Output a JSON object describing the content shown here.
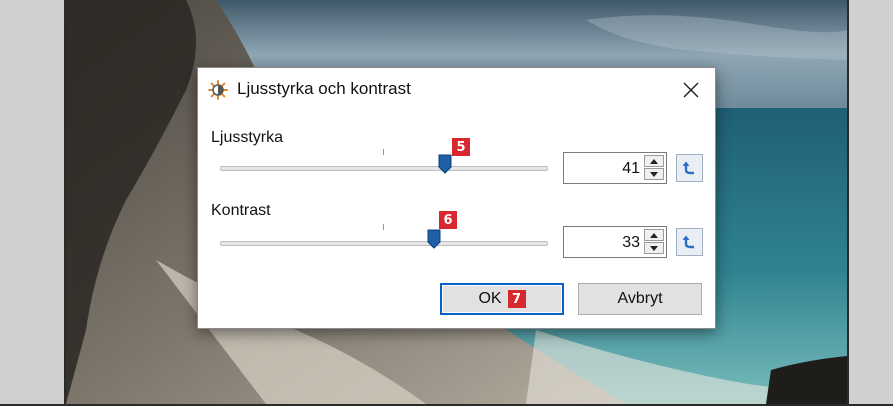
{
  "dialog": {
    "title": "Ljusstyrka och kontrast",
    "icon": "brightness-sun-icon",
    "close_icon": "close-icon"
  },
  "brightness": {
    "label": "Ljusstyrka",
    "value": "41",
    "slider_fraction": 0.69,
    "badge": "5"
  },
  "contrast": {
    "label": "Kontrast",
    "value": "33",
    "slider_fraction": 0.655,
    "badge": "6"
  },
  "buttons": {
    "ok_label": "OK",
    "ok_badge": "7",
    "cancel_label": "Avbryt"
  },
  "colors": {
    "badge": "#d7282f",
    "slider_thumb": "#1e5fa6",
    "focus_border": "#0a64c8",
    "reset_icon": "#2a6fc9"
  }
}
